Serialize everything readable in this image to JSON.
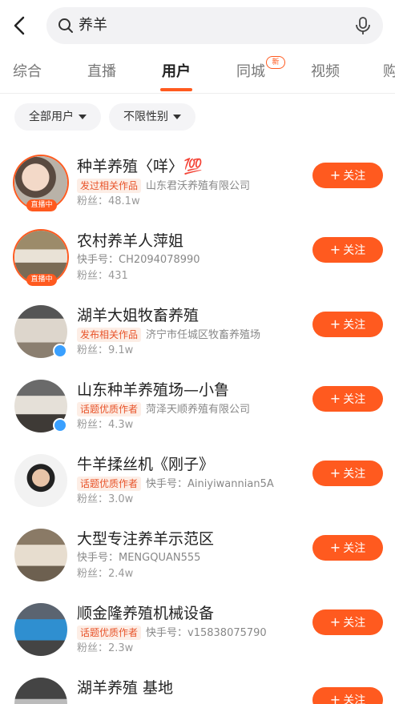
{
  "search": {
    "query": "养羊"
  },
  "tabs": [
    {
      "label": "综合"
    },
    {
      "label": "直播"
    },
    {
      "label": "用户"
    },
    {
      "label": "同城"
    },
    {
      "label": "视频"
    },
    {
      "label": "购"
    }
  ],
  "tab_badge": "新",
  "filters": [
    {
      "label": "全部用户"
    },
    {
      "label": "不限性别"
    }
  ],
  "live_label": "直播中",
  "follow_label": "关注",
  "users": [
    {
      "name": "种羊养殖〈咩〉💯",
      "tag": "发过相关作品",
      "info": "山东君沃养殖有限公司",
      "fans": "粉丝：48.1w",
      "live": true
    },
    {
      "name": "农村养羊人萍姐",
      "tag": "",
      "info": "快手号：CH2094078990",
      "fans": "粉丝：431",
      "live": true
    },
    {
      "name": "湖羊大姐牧畜养殖",
      "tag": "发布相关作品",
      "info": "济宁市任城区牧畜养殖场",
      "fans": "粉丝：9.1w",
      "verified": true
    },
    {
      "name": "山东种羊养殖场—小鲁",
      "tag": "话题优质作者",
      "info": "菏泽天顺养殖有限公司",
      "fans": "粉丝：4.3w",
      "verified": true
    },
    {
      "name": "牛羊揉丝机《刚子》",
      "tag": "话题优质作者",
      "info": "快手号：Ainiyiwannian5A",
      "fans": "粉丝：3.0w"
    },
    {
      "name": "大型专注养羊示范区",
      "tag": "",
      "info": "快手号：MENGQUAN555",
      "fans": "粉丝：2.4w"
    },
    {
      "name": "顺金隆养殖机械设备",
      "tag": "话题优质作者",
      "info": "快手号：v15838075790",
      "fans": "粉丝：2.3w"
    },
    {
      "name": "湖羊养殖 基地",
      "tag": "",
      "info": "",
      "fans": ""
    }
  ],
  "colors": {
    "accent": "#ff5a1f",
    "tag_bg": "#fdeee6",
    "verified": "#3aa0ff"
  }
}
